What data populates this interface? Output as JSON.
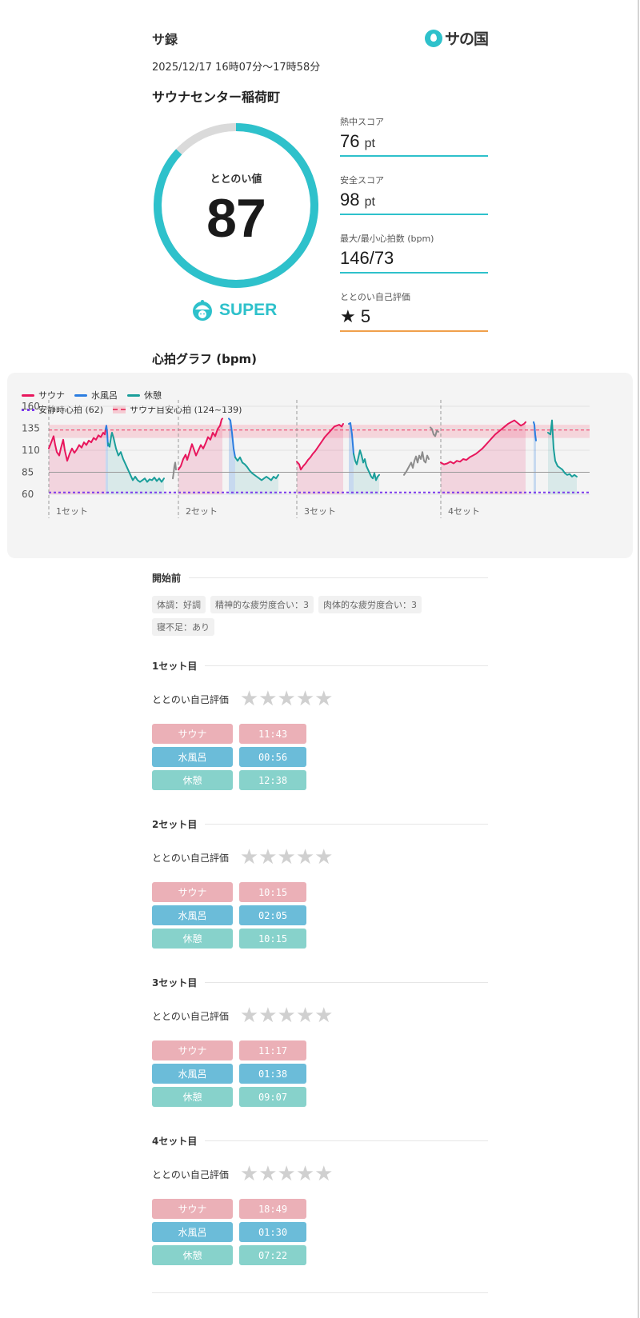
{
  "header": {
    "title": "サ録",
    "logo_text": "サの国"
  },
  "session": {
    "datetime": "2025/12/17 16時07分〜17時58分",
    "venue": "サウナセンター稲荷町"
  },
  "totonoi": {
    "label": "ととのい値",
    "value": "87",
    "score_fraction": 0.87,
    "rank": "SUPER"
  },
  "scores": [
    {
      "label": "熱中スコア",
      "value": "76",
      "unit": "pt"
    },
    {
      "label": "安全スコア",
      "value": "98",
      "unit": "pt"
    },
    {
      "label": "最大/最小心拍数 (bpm)",
      "value": "146/73",
      "unit": ""
    },
    {
      "label": "ととのい自己評価",
      "value": "★ 5",
      "unit": ""
    }
  ],
  "graph": {
    "title": "心拍グラフ (bpm)",
    "legend": {
      "sauna": "サウナ",
      "water": "水風呂",
      "rest": "休憩",
      "resting": "安静時心拍 (62)",
      "target": "サウナ目安心拍 (124~139)"
    }
  },
  "colors": {
    "accent": "#2ec1cb",
    "sauna": "#e8175d",
    "water": "#2b7de0",
    "rest": "#1a9e9a",
    "idle": "#8c8c8c",
    "resting_line": "#7c3aed",
    "target_band": "#f6cbd3",
    "star_off": "#d0d0d0"
  },
  "chart_data": {
    "type": "line",
    "title": "",
    "xlabel": "",
    "ylabel": "",
    "ylim": [
      60,
      160
    ],
    "yticks": [
      "160",
      "135",
      "110",
      "85",
      "60"
    ],
    "ytick_values": [
      160,
      135,
      110,
      85,
      60
    ],
    "reference_lines": {
      "resting": 62,
      "baseline": 85,
      "target_band": [
        124,
        139
      ],
      "target_line": 133
    },
    "set_labels": [
      "1セット",
      "2セット",
      "3セット",
      "4セット"
    ],
    "series": [
      {
        "name": "サウナ",
        "phase": "sauna",
        "segments": [
          [
            [
              0,
              112
            ],
            [
              3,
              119
            ],
            [
              6,
              126
            ],
            [
              8,
              116
            ],
            [
              10,
              108
            ],
            [
              13,
              104
            ],
            [
              15,
              112
            ],
            [
              18,
              122
            ],
            [
              20,
              110
            ],
            [
              23,
              98
            ],
            [
              26,
              106
            ],
            [
              29,
              112
            ],
            [
              32,
              107
            ],
            [
              35,
              111
            ],
            [
              38,
              116
            ],
            [
              41,
              113
            ],
            [
              44,
              119
            ],
            [
              47,
              116
            ],
            [
              50,
              121
            ],
            [
              53,
              119
            ],
            [
              56,
              124
            ],
            [
              59,
              122
            ],
            [
              62,
              127
            ],
            [
              65,
              125
            ],
            [
              68,
              130
            ],
            [
              70,
              128
            ],
            [
              71,
              134
            ]
          ],
          [
            [
              0,
              88
            ],
            [
              3,
              92
            ],
            [
              6,
              100
            ],
            [
              9,
              105
            ],
            [
              11,
              99
            ],
            [
              14,
              108
            ],
            [
              17,
              117
            ],
            [
              19,
              112
            ],
            [
              22,
              104
            ],
            [
              25,
              110
            ],
            [
              28,
              116
            ],
            [
              31,
              112
            ],
            [
              34,
              118
            ],
            [
              37,
              125
            ],
            [
              40,
              122
            ],
            [
              43,
              130
            ],
            [
              46,
              126
            ],
            [
              49,
              134
            ],
            [
              52,
              138
            ],
            [
              54,
              145
            ],
            [
              55,
              146
            ]
          ],
          [
            [
              0,
              97
            ],
            [
              3,
              94
            ],
            [
              5,
              88
            ],
            [
              8,
              92
            ],
            [
              11,
              95
            ],
            [
              14,
              99
            ],
            [
              17,
              102
            ],
            [
              20,
              106
            ],
            [
              23,
              109
            ],
            [
              26,
              113
            ],
            [
              29,
              117
            ],
            [
              32,
              121
            ],
            [
              35,
              125
            ],
            [
              38,
              128
            ],
            [
              41,
              131
            ],
            [
              44,
              134
            ],
            [
              47,
              137
            ],
            [
              50,
              138
            ],
            [
              53,
              139
            ],
            [
              56,
              137
            ],
            [
              58,
              140
            ]
          ],
          [
            [
              0,
              96
            ],
            [
              4,
              94
            ],
            [
              8,
              95
            ],
            [
              12,
              97
            ],
            [
              16,
              95
            ],
            [
              20,
              98
            ],
            [
              24,
              97
            ],
            [
              28,
              100
            ],
            [
              32,
              99
            ],
            [
              36,
              102
            ],
            [
              40,
              104
            ],
            [
              44,
              106
            ],
            [
              48,
              109
            ],
            [
              52,
              112
            ],
            [
              56,
              116
            ],
            [
              60,
              120
            ],
            [
              64,
              124
            ],
            [
              68,
              128
            ],
            [
              72,
              131
            ],
            [
              76,
              134
            ],
            [
              80,
              137
            ],
            [
              84,
              140
            ],
            [
              88,
              142
            ],
            [
              92,
              144
            ],
            [
              96,
              141
            ],
            [
              100,
              138
            ],
            [
              104,
              140
            ],
            [
              106,
              142
            ]
          ]
        ]
      },
      {
        "name": "水風呂",
        "phase": "water",
        "segments": [
          [
            [
              0,
              134
            ],
            [
              1,
              138
            ],
            [
              2,
              130
            ],
            [
              3,
              115
            ]
          ],
          [
            [
              0,
              146
            ],
            [
              2,
              144
            ],
            [
              4,
              130
            ],
            [
              6,
              112
            ],
            [
              8,
              102
            ]
          ],
          [
            [
              0,
              140
            ],
            [
              2,
              141
            ],
            [
              4,
              128
            ],
            [
              6,
              106
            ]
          ],
          [
            [
              0,
              142
            ],
            [
              1,
              139
            ],
            [
              2,
              128
            ],
            [
              3,
              121
            ]
          ]
        ]
      },
      {
        "name": "休憩",
        "phase": "rest",
        "segments": [
          [
            [
              0,
              118
            ],
            [
              2,
              114
            ],
            [
              4,
              126
            ],
            [
              5,
              130
            ],
            [
              7,
              124
            ],
            [
              10,
              112
            ],
            [
              13,
              104
            ],
            [
              16,
              108
            ],
            [
              19,
              100
            ],
            [
              22,
              94
            ],
            [
              25,
              88
            ],
            [
              28,
              82
            ],
            [
              31,
              76
            ],
            [
              34,
              80
            ],
            [
              37,
              76
            ],
            [
              40,
              74
            ],
            [
              43,
              76
            ],
            [
              46,
              78
            ],
            [
              49,
              74
            ],
            [
              52,
              77
            ],
            [
              55,
              76
            ],
            [
              58,
              79
            ],
            [
              61,
              75
            ],
            [
              64,
              78
            ],
            [
              67,
              74
            ],
            [
              70,
              78
            ]
          ],
          [
            [
              0,
              102
            ],
            [
              3,
              98
            ],
            [
              6,
              102
            ],
            [
              9,
              96
            ],
            [
              12,
              94
            ],
            [
              15,
              91
            ],
            [
              18,
              87
            ],
            [
              21,
              84
            ],
            [
              24,
              82
            ],
            [
              27,
              80
            ],
            [
              30,
              78
            ],
            [
              33,
              76
            ],
            [
              36,
              78
            ],
            [
              39,
              80
            ],
            [
              42,
              78
            ],
            [
              45,
              76
            ],
            [
              48,
              80
            ],
            [
              51,
              78
            ],
            [
              54,
              82
            ]
          ],
          [
            [
              0,
              106
            ],
            [
              2,
              98
            ],
            [
              4,
              94
            ],
            [
              6,
              102
            ],
            [
              8,
              110
            ],
            [
              10,
              104
            ],
            [
              12,
              96
            ],
            [
              14,
              100
            ],
            [
              16,
              92
            ],
            [
              18,
              88
            ],
            [
              20,
              84
            ],
            [
              22,
              80
            ],
            [
              24,
              78
            ],
            [
              26,
              84
            ],
            [
              28,
              76
            ],
            [
              30,
              80
            ],
            [
              32,
              82
            ]
          ],
          [
            [
              0,
              130
            ],
            [
              3,
              128
            ],
            [
              5,
              144
            ],
            [
              7,
              112
            ],
            [
              9,
              98
            ],
            [
              12,
              92
            ],
            [
              15,
              90
            ],
            [
              18,
              88
            ],
            [
              21,
              84
            ],
            [
              24,
              82
            ],
            [
              27,
              83
            ],
            [
              30,
              80
            ],
            [
              33,
              82
            ],
            [
              36,
              80
            ]
          ]
        ]
      },
      {
        "name": "",
        "phase": "idle",
        "segments": [
          [
            [
              0,
              78
            ],
            [
              1,
              84
            ],
            [
              2,
              92
            ],
            [
              3,
              96
            ],
            [
              4,
              88
            ]
          ],
          [
            [
              0,
              82
            ],
            [
              3,
              86
            ],
            [
              6,
              91
            ],
            [
              9,
              96
            ],
            [
              11,
              90
            ],
            [
              13,
              98
            ],
            [
              15,
              103
            ],
            [
              17,
              96
            ],
            [
              19,
              104
            ],
            [
              21,
              100
            ],
            [
              23,
              108
            ],
            [
              25,
              98
            ],
            [
              27,
              96
            ],
            [
              29,
              104
            ],
            [
              31,
              100
            ]
          ],
          [
            [
              0,
              136
            ],
            [
              2,
              134
            ],
            [
              4,
              128
            ],
            [
              6,
              126
            ],
            [
              8,
              132
            ],
            [
              10,
              131
            ]
          ]
        ]
      }
    ]
  },
  "sections": {
    "before": {
      "title": "開始前",
      "chips": [
        "体調：好調",
        "精神的な疲労度合い：3",
        "肉体的な疲労度合い：3",
        "寝不足：あり"
      ]
    },
    "rating_label": "ととのい自己評価",
    "labels": {
      "sauna": "サウナ",
      "water": "水風呂",
      "rest": "休憩"
    },
    "sets": [
      {
        "title": "1セット目",
        "rating": 0,
        "sauna": "11:43",
        "water": "00:56",
        "rest": "12:38"
      },
      {
        "title": "2セット目",
        "rating": 0,
        "sauna": "10:15",
        "water": "02:05",
        "rest": "10:15"
      },
      {
        "title": "3セット目",
        "rating": 0,
        "sauna": "11:17",
        "water": "01:38",
        "rest": "09:07"
      },
      {
        "title": "4セット目",
        "rating": 0,
        "sauna": "18:49",
        "water": "01:30",
        "rest": "07:22"
      }
    ]
  }
}
